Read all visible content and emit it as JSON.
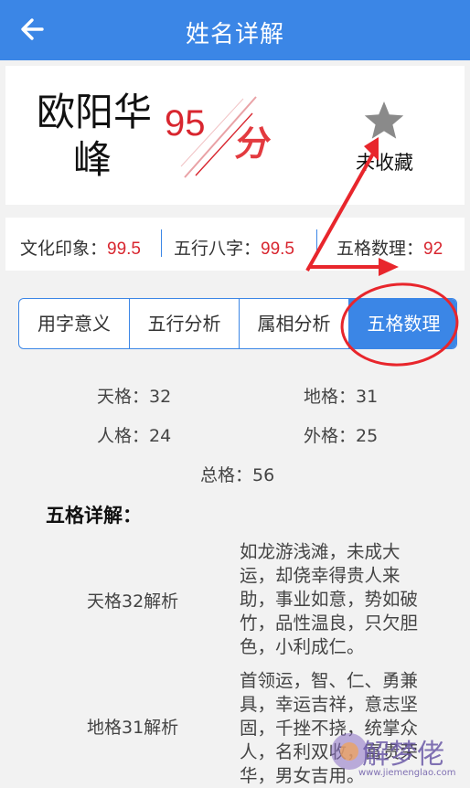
{
  "header": {
    "title": "姓名详解",
    "back_icon": "arrow-left-icon"
  },
  "name": {
    "line1": "欧阳华",
    "line2": "峰"
  },
  "score": {
    "value": "95",
    "unit": "分"
  },
  "favorite": {
    "icon": "star-icon",
    "label": "未收藏"
  },
  "ratings": [
    {
      "label": "文化印象：",
      "value": "99.5"
    },
    {
      "label": "五行八字：",
      "value": "99.5"
    },
    {
      "label": "五格数理：",
      "value": "92"
    }
  ],
  "tabs": [
    {
      "label": "用字意义"
    },
    {
      "label": "五行分析"
    },
    {
      "label": "属相分析"
    },
    {
      "label": "五格数理",
      "active": true
    }
  ],
  "wuge": {
    "tian": "天格：32",
    "di": "地格：31",
    "ren": "人格：24",
    "wai": "外格：25",
    "zong": "总格：56"
  },
  "details": {
    "title": "五格详解：",
    "rows": [
      {
        "label": "天格32解析",
        "lines": [
          "如龙游浅滩，未成大",
          "运，却侥幸得贵人来",
          "助，事业如意，势如破",
          "竹，品性温良，只欠胆",
          "色，小利成仁。"
        ]
      },
      {
        "label": "地格31解析",
        "lines": [
          "首领运，智、仁、勇兼",
          "具，幸运吉祥，意志坚",
          "固，千挫不挠，统掌众",
          "人，名利双收，富贵荣",
          "华，男女吉用。"
        ]
      }
    ]
  },
  "colors": {
    "primary": "#3b86e6",
    "score_red": "#d8262f"
  },
  "watermark": {
    "text": "解梦佬",
    "url": "www.jiemenglao.com"
  }
}
